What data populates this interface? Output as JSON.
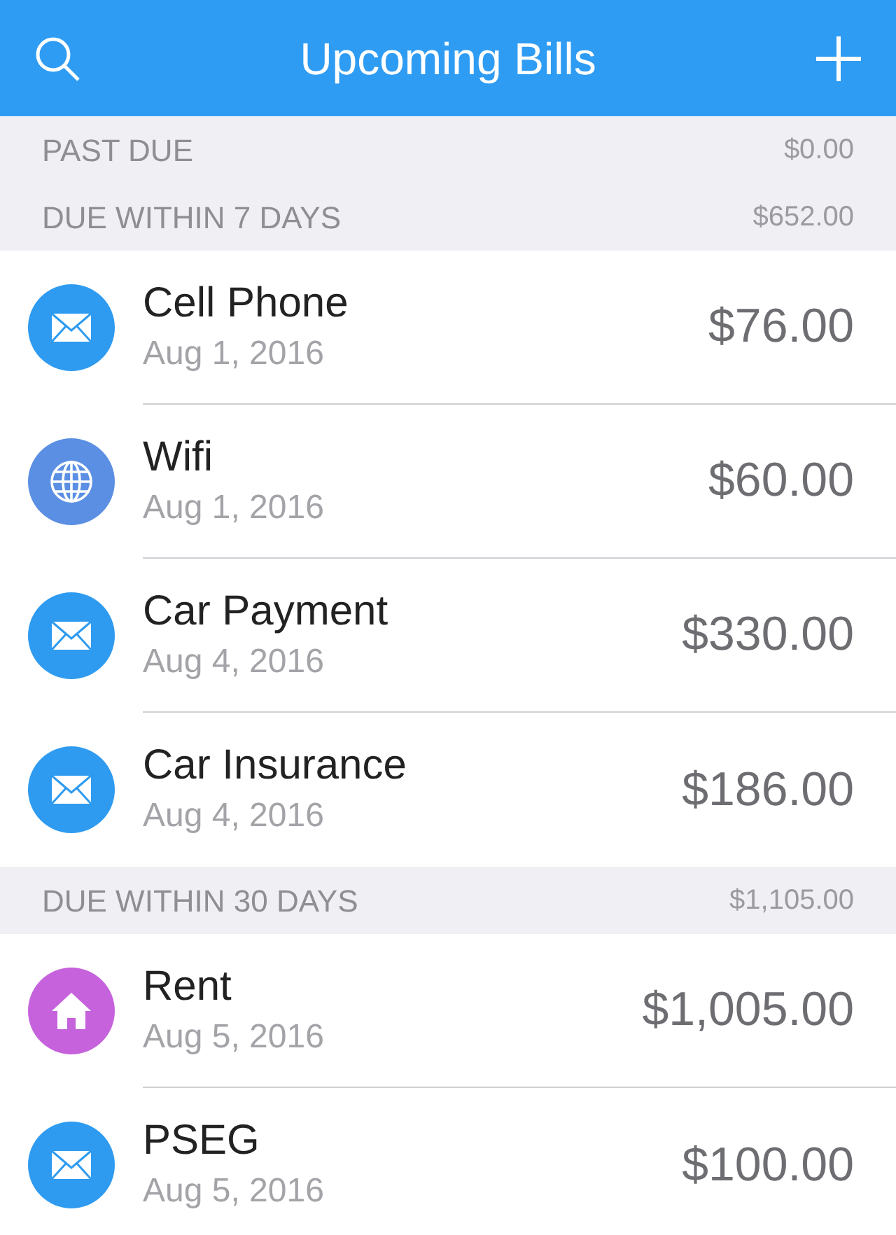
{
  "header": {
    "title": "Upcoming Bills"
  },
  "sections": [
    {
      "title": "PAST DUE",
      "total": "$0.00"
    },
    {
      "title": "DUE WITHIN 7 DAYS",
      "total": "$652.00",
      "bills": [
        {
          "name": "Cell Phone",
          "date": "Aug 1, 2016",
          "amount": "$76.00",
          "kind": "envelope",
          "color": "#2e9bf0"
        },
        {
          "name": "Wifi",
          "date": "Aug 1, 2016",
          "amount": "$60.00",
          "kind": "globe",
          "color": "#5b8fe3"
        },
        {
          "name": "Car Payment",
          "date": "Aug 4, 2016",
          "amount": "$330.00",
          "kind": "envelope",
          "color": "#2e9bf0"
        },
        {
          "name": "Car Insurance",
          "date": "Aug 4, 2016",
          "amount": "$186.00",
          "kind": "envelope",
          "color": "#2e9bf0"
        }
      ]
    },
    {
      "title": "DUE WITHIN 30 DAYS",
      "total": "$1,105.00",
      "bills": [
        {
          "name": "Rent",
          "date": "Aug 5, 2016",
          "amount": "$1,005.00",
          "kind": "house",
          "color": "#c562dc"
        },
        {
          "name": "PSEG",
          "date": "Aug 5, 2016",
          "amount": "$100.00",
          "kind": "envelope",
          "color": "#2e9bf0"
        }
      ]
    }
  ]
}
